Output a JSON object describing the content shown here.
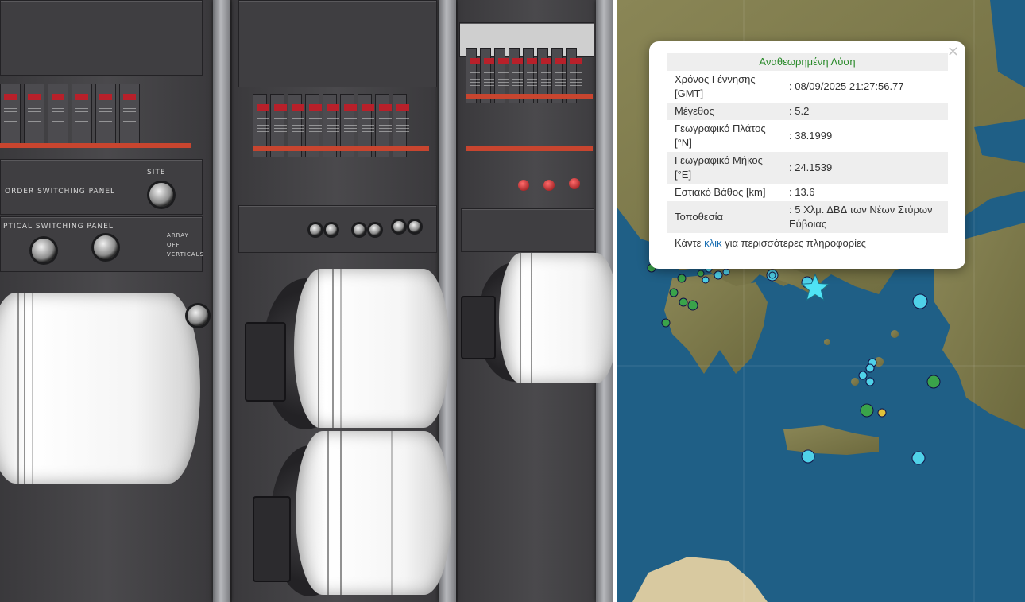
{
  "popup": {
    "title": "Αναθεωρημένη Λύση",
    "close_label": "×",
    "rows": [
      {
        "label": "Χρόνος Γέννησης [GMT]",
        "value": ": 08/09/2025 21:27:56.77"
      },
      {
        "label": "Μέγεθος",
        "value": ": 5.2"
      },
      {
        "label": "Γεωγραφικό Πλάτος [°N]",
        "value": ": 38.1999"
      },
      {
        "label": "Γεωγραφικό Μήκος [°E]",
        "value": ": 24.1539"
      },
      {
        "label": "Εστιακό Βάθος [km]",
        "value": ": 13.6"
      },
      {
        "label": "Τοποθεσία",
        "value": ": 5 Χλμ. ΔΒΔ των Νέων Στύρων Εύβοιας"
      }
    ],
    "footer_prefix": "Κάντε ",
    "footer_link": "κλικ",
    "footer_suffix": " για περισσότερες πληροφορίες"
  },
  "photo": {
    "panel_label_1": "ORDER SWITCHING PANEL",
    "panel_label_2": "PTICAL SWITCHING PANEL",
    "site_label": "SITE",
    "array_label": "ARRAY",
    "off_label": "OFF",
    "verticals_label": "VERTICALS"
  },
  "colors": {
    "sea": "#1f5f86",
    "land": "#7d7a4a",
    "marker_cyan": "#4fd1e8",
    "marker_green": "#3aa34a",
    "marker_yellow": "#e0c23a",
    "epicenter_star": "#4fe3f5",
    "popup_title_green": "#2a8a2a"
  },
  "icons": {
    "close": "close-icon",
    "epicenter": "star-icon"
  }
}
